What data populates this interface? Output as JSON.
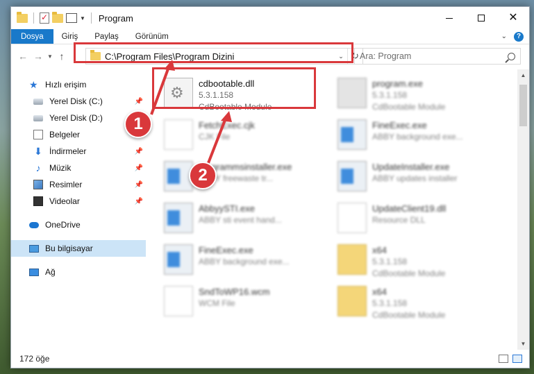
{
  "window": {
    "title": "Program",
    "qat_icons": [
      "folder-icon",
      "properties-check-icon",
      "folder-icon",
      "properties-icon"
    ]
  },
  "ribbon": {
    "tabs": [
      "Dosya",
      "Giriş",
      "Paylaş",
      "Görünüm"
    ],
    "colors": {
      "file_tab": "#1979ca"
    }
  },
  "address": {
    "path": "C:\\Program Files\\Program Dizini",
    "search_placeholder": "Ara: Program"
  },
  "nav": {
    "items": [
      {
        "label": "Hızlı erişim",
        "icon": "star-icon",
        "pinned": false
      },
      {
        "label": "Yerel Disk (C:)",
        "icon": "disk-icon",
        "pinned": true
      },
      {
        "label": "Yerel Disk (D:)",
        "icon": "disk-icon",
        "pinned": true
      },
      {
        "label": "Belgeler",
        "icon": "documents-icon",
        "pinned": true
      },
      {
        "label": "İndirmeler",
        "icon": "downloads-icon",
        "pinned": true
      },
      {
        "label": "Müzik",
        "icon": "music-icon",
        "pinned": true
      },
      {
        "label": "Resimler",
        "icon": "pictures-icon",
        "pinned": true
      },
      {
        "label": "Videolar",
        "icon": "videos-icon",
        "pinned": true
      },
      {
        "label": "OneDrive",
        "icon": "cloud-icon",
        "pinned": false
      },
      {
        "label": "Bu bilgisayar",
        "icon": "computer-icon",
        "pinned": false,
        "selected": true
      },
      {
        "label": "Ağ",
        "icon": "network-icon",
        "pinned": false
      }
    ]
  },
  "files": [
    {
      "name": "cdbootable.dll",
      "line2": "5.3.1.158",
      "line3": "CdBootable Module",
      "icon": "dll-icon",
      "highlighted": true
    },
    {
      "name": "program.exe",
      "line2": "5.3.1.158",
      "line3": "CdBootable Module",
      "icon": "exe-icon",
      "blurred": true
    },
    {
      "name": "FetchExec.cjk",
      "line2": "CJK File",
      "icon": "doc-icon",
      "blurred": true
    },
    {
      "name": "FineExec.exe",
      "line2": "ABBY background exe...",
      "icon": "window-icon",
      "blurred": true
    },
    {
      "name": "programmsinstaller.exe",
      "line2": "ABBY freewaste tr...",
      "icon": "window-icon",
      "blurred": true
    },
    {
      "name": "UpdateInstaller.exe",
      "line2": "ABBY updates installer",
      "icon": "window-icon",
      "blurred": true
    },
    {
      "name": "AbbyySTI.exe",
      "line2": "ABBY sti event hand...",
      "icon": "window-icon",
      "blurred": true
    },
    {
      "name": "UpdateClient19.dll",
      "line2": "Resource DLL",
      "icon": "doc-icon",
      "blurred": true
    },
    {
      "name": "FineExec.exe",
      "line2": "ABBY background exe...",
      "icon": "window-icon",
      "blurred": true
    },
    {
      "name": "x64",
      "line2": "5.3.1.158",
      "line3": "CdBootable Module",
      "icon": "zip-icon",
      "blurred": true
    },
    {
      "name": "SndToWP16.wcm",
      "line2": "WCM File",
      "icon": "doc-icon",
      "blurred": true
    },
    {
      "name": "x64",
      "line2": "5.3.1.158",
      "line3": "CdBootable Module",
      "icon": "zip-icon",
      "blurred": true
    }
  ],
  "status": {
    "item_count": "172 öğe"
  },
  "callouts": {
    "one": "1",
    "two": "2",
    "color": "#d9383b"
  }
}
